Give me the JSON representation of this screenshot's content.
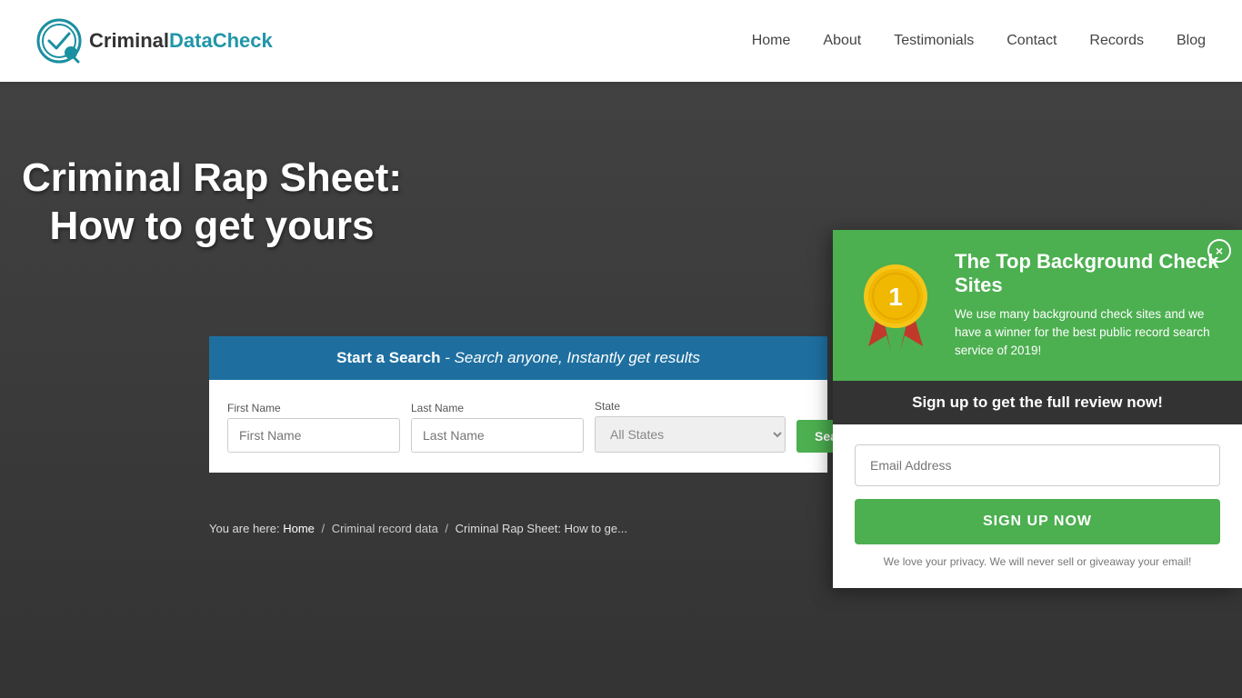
{
  "header": {
    "logo_text_criminal": "Criminal",
    "logo_text_data": "Data",
    "logo_text_check": "Check",
    "nav": {
      "home": "Home",
      "about": "About",
      "testimonials": "Testimonials",
      "contact": "Contact",
      "records": "Records",
      "blog": "Blog"
    }
  },
  "hero": {
    "title": "Criminal Rap Sheet: How to get yours"
  },
  "search": {
    "header_bold": "Start a Search",
    "header_italic": "- Search anyone, Instantly get results",
    "first_name_label": "First Name",
    "first_name_placeholder": "First Name",
    "last_name_label": "Last Name",
    "last_name_placeholder": "Last Name",
    "state_label": "State",
    "state_default": "All States",
    "search_btn": "Search Now"
  },
  "breadcrumb": {
    "prefix": "You are here: ",
    "home": "Home",
    "criminal_record": "Criminal record data",
    "current": "Criminal Rap Sheet: How to ge..."
  },
  "popup": {
    "title": "The Top Background Check Sites",
    "medal_number": "1",
    "description": "We use many background check sites and we have a winner for the best public record search service of 2019!",
    "subtitle": "Sign up to get the full review now!",
    "email_placeholder": "Email Address",
    "signup_btn": "SIGN UP NOW",
    "privacy": "We love your privacy.  We will never sell or giveaway your email!",
    "close_label": "×"
  }
}
